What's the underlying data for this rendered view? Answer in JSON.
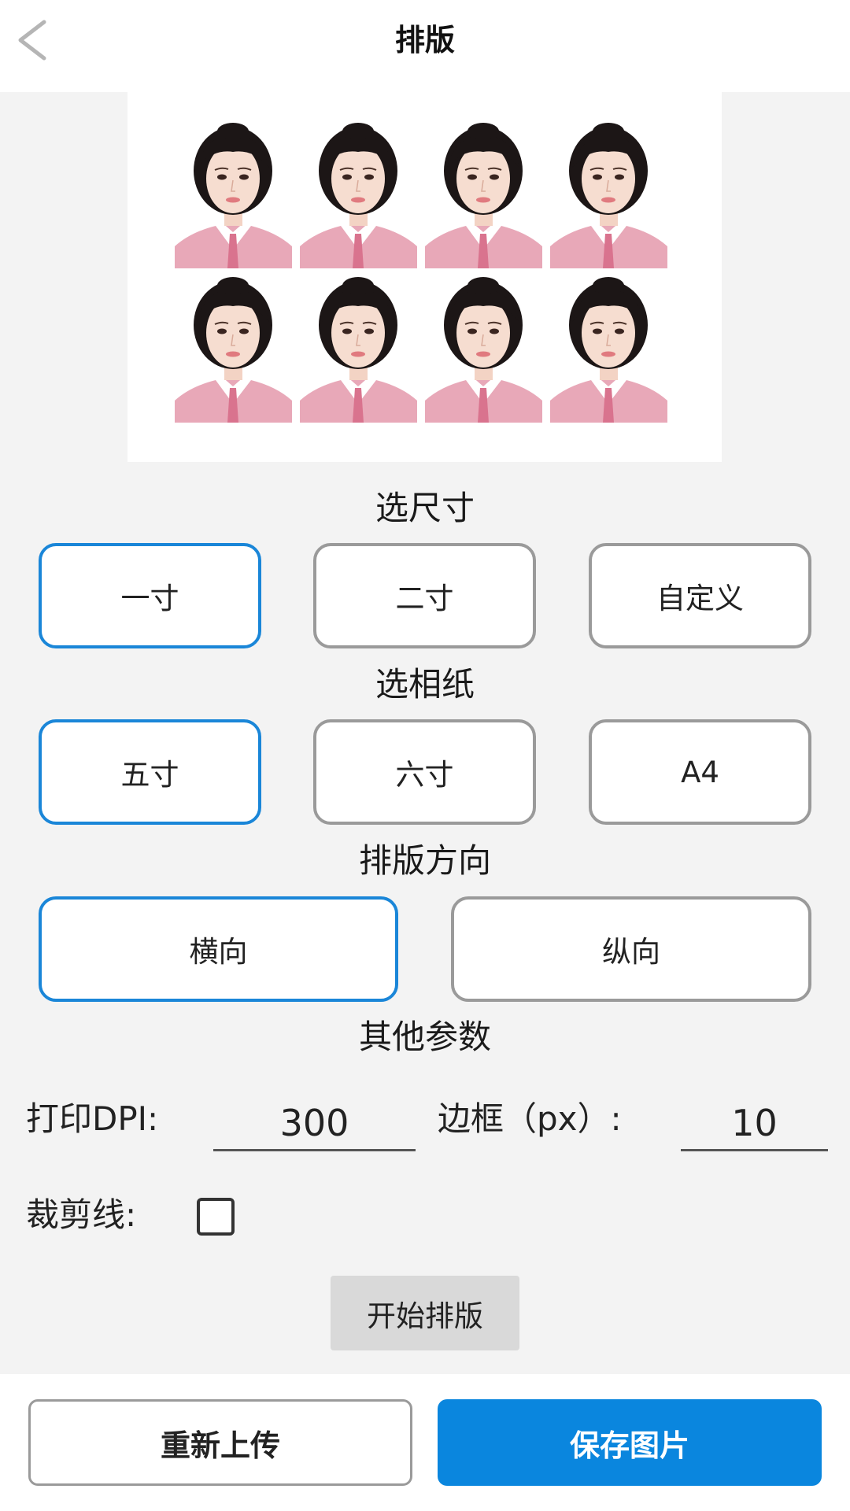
{
  "header": {
    "title": "排版",
    "back_icon": "chevron-left-icon"
  },
  "preview": {
    "photo_count": 8,
    "rows": 2,
    "columns": 4
  },
  "size_section": {
    "title": "选尺寸",
    "options": [
      "一寸",
      "二寸",
      "自定义"
    ],
    "selected": "一寸"
  },
  "paper_section": {
    "title": "选相纸",
    "options": [
      "五寸",
      "六寸",
      "A4"
    ],
    "selected": "五寸"
  },
  "orientation_section": {
    "title": "排版方向",
    "options": [
      "横向",
      "纵向"
    ],
    "selected": "横向"
  },
  "params_section": {
    "title": "其他参数",
    "dpi_label": "打印DPI:",
    "dpi_value": "300",
    "border_label": "边框（px）:",
    "border_value": "10",
    "cutline_label": "裁剪线:",
    "cutline_checked": false
  },
  "start_button": "开始排版",
  "footer": {
    "reupload_label": "重新上传",
    "save_label": "保存图片"
  },
  "colors": {
    "accent": "#0a86de",
    "selected_border": "#1a86d8",
    "unselected_border": "#9a9a9a",
    "background": "#f3f3f3"
  }
}
